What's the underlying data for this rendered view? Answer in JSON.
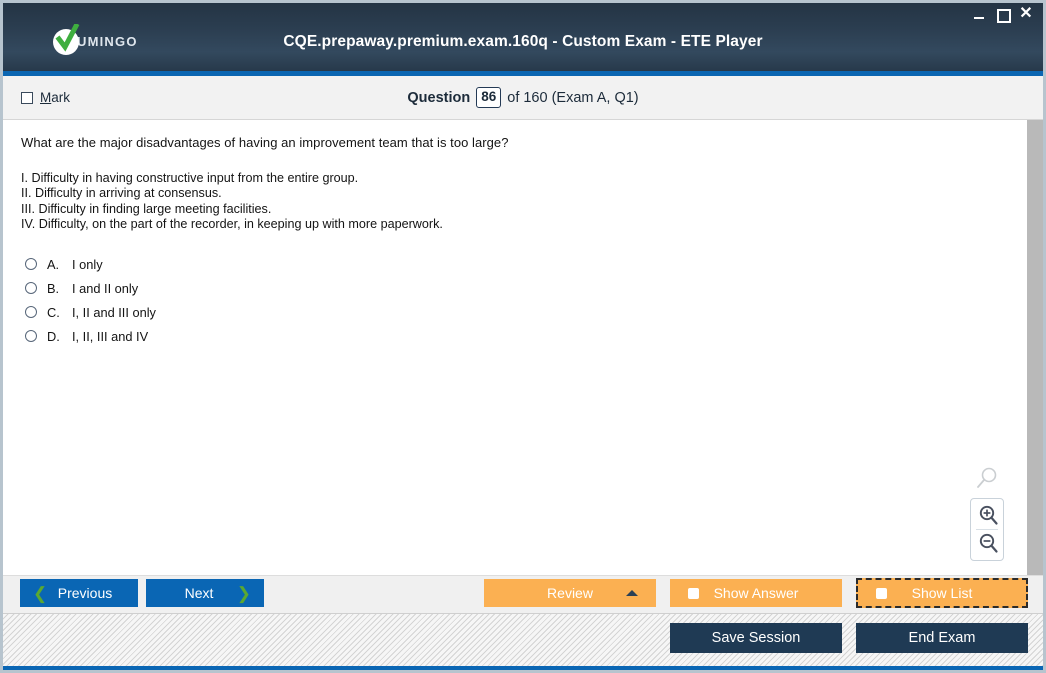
{
  "window": {
    "title": "CQE.prepaway.premium.exam.160q - Custom Exam - ETE Player",
    "logo_text": "UMINGO",
    "controls": {
      "minimize": "−",
      "maximize": "□",
      "close": "✕"
    },
    "accent_blue": "#0a66b4",
    "titlebar_navy": "#2c3f52"
  },
  "question_header": {
    "mark_label_prefix": "M",
    "mark_label_rest": "ark",
    "question_word": "Question",
    "question_number": "86",
    "question_total_text": "of 160 (Exam A, Q1)"
  },
  "question": {
    "prompt": "What are the major disadvantages of having an improvement team that is too large?",
    "statements": [
      "I. Difficulty in having constructive input from the entire group.",
      "II. Difficulty in arriving at consensus.",
      "III. Difficulty in finding large meeting facilities.",
      "IV. Difficulty, on the part of the recorder, in keeping up with more paperwork."
    ],
    "options": [
      {
        "letter": "A.",
        "text": "I only",
        "selected": false
      },
      {
        "letter": "B.",
        "text": "I and II only",
        "selected": false
      },
      {
        "letter": "C.",
        "text": "I, II and III only",
        "selected": false
      },
      {
        "letter": "D.",
        "text": "I, II, III and IV",
        "selected": false
      }
    ]
  },
  "zoom_controls": {
    "ghost_icon": "magnifier-icon",
    "zoom_in_icon": "magnifier-plus-icon",
    "zoom_out_icon": "magnifier-minus-icon"
  },
  "nav": {
    "previous": "Previous",
    "next": "Next",
    "review": "Review",
    "show_answer": "Show Answer",
    "show_list": "Show List",
    "prev_chevron": "❮",
    "next_chevron": "❯",
    "review_chevron": "▲",
    "button_blue": "#0a66b4",
    "button_orange": "#fbb052",
    "chevron_green": "#5aa832"
  },
  "footer": {
    "save_session": "Save Session",
    "end_exam": "End Exam",
    "button_navy": "#1f3a54"
  }
}
